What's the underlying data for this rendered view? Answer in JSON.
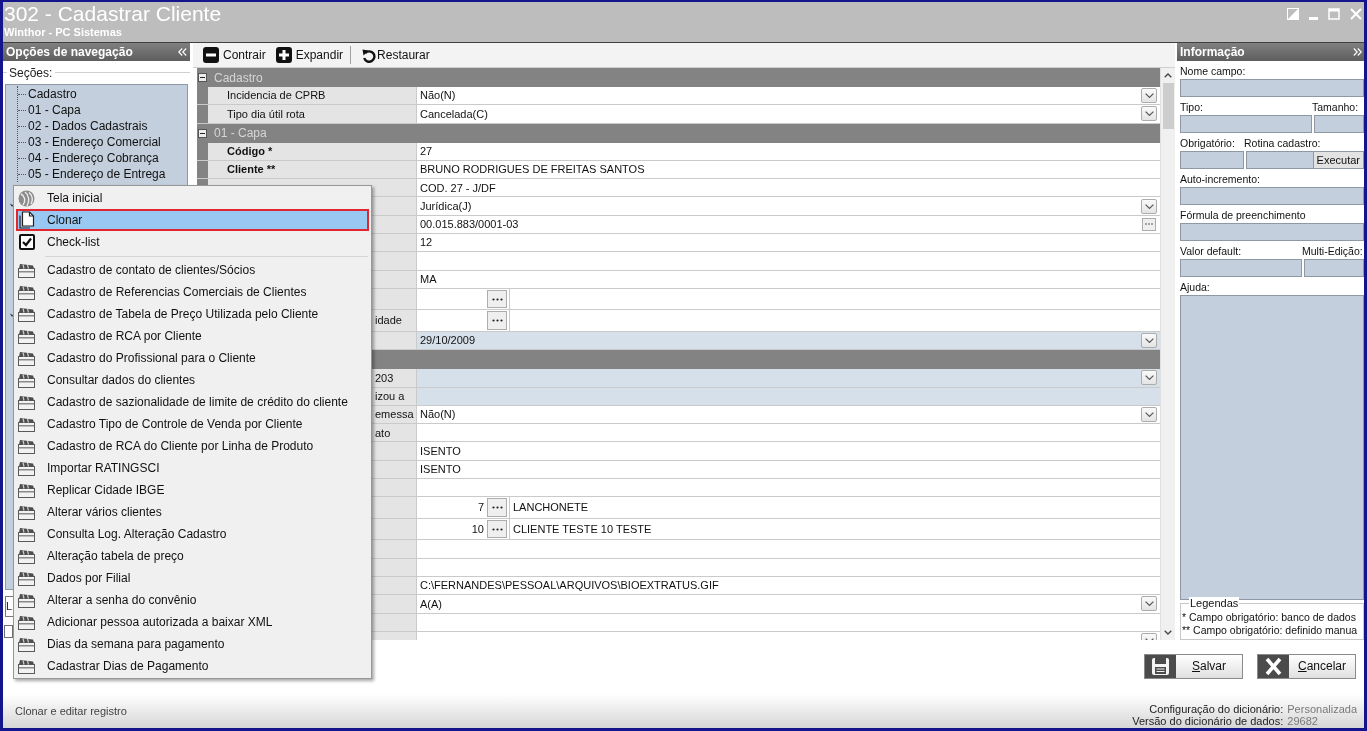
{
  "window": {
    "title": "302 - Cadastrar Cliente",
    "subtitle": "Winthor - PC Sistemas"
  },
  "navigation": {
    "title": "Opções de navegação",
    "sections_label": "Seções:",
    "tree": [
      {
        "label": "Cadastro",
        "selected": false
      },
      {
        "label": "01 - Capa",
        "selected": false
      },
      {
        "label": "02 - Dados Cadastrais",
        "selected": false
      },
      {
        "label": "03 - Endereço Comercial",
        "selected": false
      },
      {
        "label": "04 - Endereço Cobrança",
        "selected": false
      },
      {
        "label": "05 - Endereço de Entrega",
        "selected": false
      }
    ],
    "text_field": {
      "value": "L"
    },
    "checkbox": {
      "checked": false
    }
  },
  "toolbar": [
    [
      {
        "kind": "collapse",
        "label": "Contrair"
      },
      {
        "kind": "expand",
        "label": "Expandir"
      }
    ],
    [
      {
        "kind": "restore",
        "label": "Restaurar"
      }
    ]
  ],
  "grid": {
    "rows": [
      {
        "kind": "group",
        "label": "Cadastro",
        "expanded": true
      },
      {
        "kind": "dropdown",
        "label": "Incidencia de CPRB",
        "required": false,
        "readonly": false,
        "value": "Não(N)"
      },
      {
        "kind": "dropdown",
        "label": "Tipo dia útil rota",
        "required": false,
        "readonly": false,
        "value": "Cancelada(C)"
      },
      {
        "kind": "group",
        "label": "01 - Capa",
        "expanded": true
      },
      {
        "kind": "text",
        "label": "Código *",
        "required": true,
        "readonly": false,
        "value": "27"
      },
      {
        "kind": "text",
        "label": "Cliente **",
        "required": true,
        "readonly": false,
        "value": "BRUNO RODRIGUES DE FREITAS SANTOS"
      },
      {
        "kind": "text",
        "readonly": false,
        "value": "COD. 27 - J/DF"
      },
      {
        "kind": "dropdown",
        "readonly": false,
        "value": "Jurídica(J)"
      },
      {
        "kind": "ellipsis",
        "readonly": false,
        "value": "00.015.883/0001-03"
      },
      {
        "kind": "text",
        "readonly": false,
        "value": "12"
      },
      {
        "kind": "text",
        "readonly": false
      },
      {
        "kind": "text",
        "readonly": false,
        "value": "MA"
      },
      {
        "kind": "lookup",
        "readonly": false
      },
      {
        "kind": "lookup",
        "label": "idade",
        "required": false,
        "readonly": false
      },
      {
        "kind": "dropdown",
        "readonly": true,
        "value": "29/10/2009"
      },
      {
        "kind": "group"
      },
      {
        "kind": "dropdown",
        "label": "203",
        "required": false,
        "readonly": true
      },
      {
        "kind": "text",
        "label": "izou a",
        "required": false,
        "readonly": true
      },
      {
        "kind": "dropdown",
        "label": "emessa",
        "required": false,
        "readonly": false,
        "value": "Não(N)"
      },
      {
        "kind": "text",
        "label": "ato",
        "required": false,
        "readonly": false
      },
      {
        "kind": "text",
        "readonly": false,
        "value": "ISENTO"
      },
      {
        "kind": "text",
        "readonly": false,
        "value": "ISENTO"
      },
      {
        "kind": "text",
        "readonly": false
      },
      {
        "kind": "lookup",
        "readonly": false,
        "code": "7",
        "description": "LANCHONETE"
      },
      {
        "kind": "lookup",
        "readonly": false,
        "code": "10",
        "description": "CLIENTE TESTE 10 TESTE"
      },
      {
        "kind": "text",
        "readonly": false
      },
      {
        "kind": "text",
        "readonly": false
      },
      {
        "kind": "text",
        "readonly": false,
        "value": "C:\\FERNANDES\\PESSOAL\\ARQUIVOS\\BIOEXTRATUS.GIF"
      },
      {
        "kind": "dropdown",
        "readonly": false,
        "value": "A(A)"
      },
      {
        "kind": "text",
        "readonly": false
      },
      {
        "kind": "dropdown",
        "readonly": false
      }
    ]
  },
  "info_panel": {
    "title": "Informação",
    "rows": [
      [
        {
          "label": "Nome campo:"
        }
      ],
      [
        {
          "label": "Tipo:"
        },
        {
          "label": "Tamanho:"
        }
      ],
      [
        {
          "label": "Obrigatório:"
        },
        {
          "label": "Rotina cadastro:",
          "button": "Executar"
        }
      ],
      [
        {
          "label": "Auto-incremento:"
        }
      ],
      [
        {
          "label": "Fórmula de preenchimento"
        }
      ],
      [
        {
          "label": "Valor default:"
        },
        {
          "label": "Multi-Edição:"
        }
      ]
    ],
    "help": {
      "label": "Ajuda:"
    },
    "legend": {
      "title": "Legendas",
      "lines": [
        "* Campo obrigatório: banco de dados",
        "** Campo obrigatório: definido manua"
      ]
    }
  },
  "buttons": [
    {
      "kind": "save",
      "label": "Salvar"
    },
    {
      "kind": "cancel",
      "label": "Cancelar"
    }
  ],
  "status_bar": {
    "message": "Clonar e editar registro",
    "details": [
      {
        "label": "Configuração do dicionário:",
        "value": "Personalizada"
      },
      {
        "label": "Versão do dicionário de dados:",
        "value": "29682"
      }
    ]
  },
  "context_menu": {
    "groups": [
      [
        {
          "kind": "home",
          "label": "Tela inicial",
          "selected": false
        },
        {
          "kind": "clone",
          "label": "Clonar",
          "selected": true
        },
        {
          "kind": "checklist",
          "label": "Check-list",
          "selected": false
        }
      ],
      [
        {
          "kind": "routine",
          "label": "Cadastro de contato de clientes/Sócios",
          "selected": false
        },
        {
          "kind": "routine",
          "label": "Cadastro de Referencias Comerciais de Clientes",
          "selected": false
        },
        {
          "kind": "routine",
          "label": "Cadastro de Tabela de Preço Utilizada pelo Cliente",
          "selected": false
        },
        {
          "kind": "routine",
          "label": "Cadastro de RCA por Cliente",
          "selected": false
        },
        {
          "kind": "routine",
          "label": "Cadastro do Profissional para o Cliente",
          "selected": false
        },
        {
          "kind": "routine",
          "label": "Consultar dados do clientes",
          "selected": false
        },
        {
          "kind": "routine",
          "label": "Cadastro de sazionalidade de limite de crédito do cliente",
          "selected": false
        },
        {
          "kind": "routine",
          "label": "Cadastro Tipo de Controle de Venda por Cliente",
          "selected": false
        },
        {
          "kind": "routine",
          "label": "Cadastro de RCA do Cliente por Linha de Produto",
          "selected": false
        },
        {
          "kind": "routine",
          "label": "Importar RATINGSCI",
          "selected": false
        },
        {
          "kind": "routine",
          "label": "Replicar Cidade IBGE",
          "selected": false
        },
        {
          "kind": "routine",
          "label": "Alterar vários clientes",
          "selected": false
        },
        {
          "kind": "routine",
          "label": "Consulta Log. Alteração Cadastro",
          "selected": false
        },
        {
          "kind": "routine",
          "label": "Alteração tabela de preço",
          "selected": false
        },
        {
          "kind": "routine",
          "label": "Dados por Filial",
          "selected": false
        },
        {
          "kind": "routine",
          "label": "Alterar a senha do convênio",
          "selected": false
        },
        {
          "kind": "routine",
          "label": "Adicionar pessoa autorizada a baixar XML",
          "selected": false
        },
        {
          "kind": "routine",
          "label": "Dias da semana para pagamento",
          "selected": false
        },
        {
          "kind": "routine",
          "label": "Cadastrar Dias de Pagamento",
          "selected": false
        }
      ]
    ]
  }
}
